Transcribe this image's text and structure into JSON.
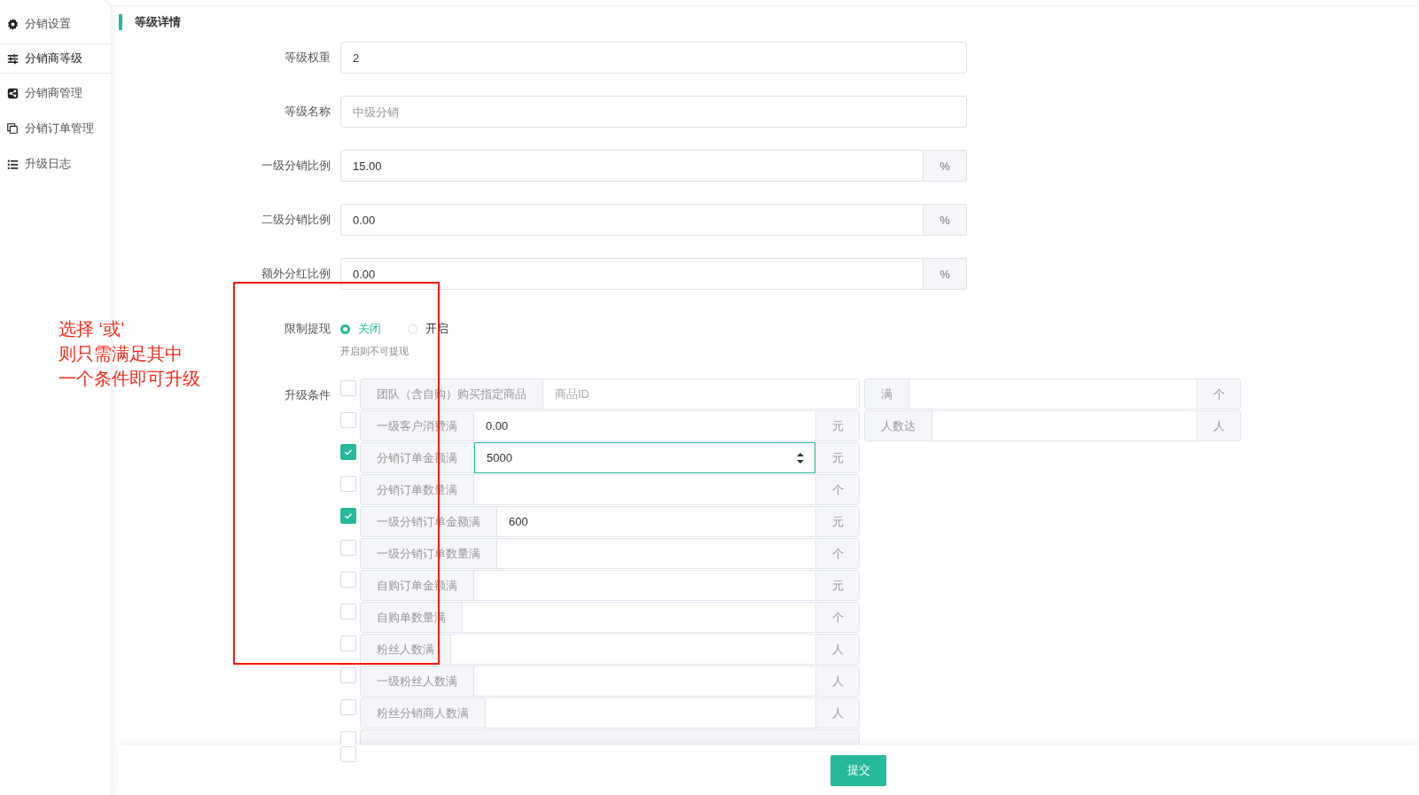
{
  "sidebar": {
    "items": [
      {
        "label": "分销设置",
        "selected": false
      },
      {
        "label": "分销商等级",
        "selected": true
      },
      {
        "label": "分销商管理",
        "selected": false
      },
      {
        "label": "分销订单管理",
        "selected": false
      },
      {
        "label": "升级日志",
        "selected": false
      }
    ]
  },
  "section_title": "等级详情",
  "fields": [
    {
      "label": "等级权重",
      "value": "2"
    },
    {
      "label": "等级名称",
      "placeholder": "中级分销"
    },
    {
      "label": "一级分销比例",
      "value": "15.00",
      "unit": "%"
    },
    {
      "label": "二级分销比例",
      "value": "0.00",
      "unit": "%"
    },
    {
      "label": "额外分红比例",
      "value": "0.00",
      "unit": "%"
    }
  ],
  "withdraw_limit": {
    "label": "限制提现",
    "options": [
      {
        "label": "关闭",
        "selected": true
      },
      {
        "label": "开启",
        "selected": false
      }
    ],
    "hint": "开启则不可提现"
  },
  "upgrade_conditions": {
    "label": "升级条件",
    "rows": [
      {
        "kind": "full",
        "checked": false,
        "label": "团队（含自购）购买指定商品",
        "placeholder": "商品ID",
        "extra": {
          "label": "满",
          "unit": "个"
        }
      },
      {
        "kind": "full",
        "checked": false,
        "label": "一级客户消费满",
        "value": "0.00",
        "unit": "元",
        "extra": {
          "label": "人数达",
          "unit": "人"
        }
      },
      {
        "kind": "full",
        "checked": true,
        "label": "分销订单金额满",
        "value": "5000",
        "unit": "元",
        "focused": true
      },
      {
        "kind": "full",
        "checked": false,
        "label": "分销订单数量满",
        "unit": "个"
      },
      {
        "kind": "full",
        "checked": true,
        "label": "一级分销订单金额满",
        "value": "600",
        "unit": "元"
      },
      {
        "kind": "full",
        "checked": false,
        "label": "一级分销订单数量满",
        "unit": "个"
      },
      {
        "kind": "full",
        "checked": false,
        "label": "自购订单金额满",
        "unit": "元"
      },
      {
        "kind": "full",
        "checked": false,
        "label": "自购单数量满",
        "unit": "个"
      },
      {
        "kind": "full",
        "checked": false,
        "label": "粉丝人数满",
        "unit": "人"
      },
      {
        "kind": "full",
        "checked": false,
        "label": "一级粉丝人数满",
        "unit": "人"
      },
      {
        "kind": "full",
        "checked": false,
        "label": "粉丝分销商人数满",
        "unit": "人"
      },
      {
        "kind": "hidden",
        "checked": false
      },
      {
        "kind": "checkbox_only",
        "checked": false
      }
    ]
  },
  "footer": {
    "submit": "提交"
  },
  "annotation": {
    "lines": [
      "选择 ‘或’",
      "则只需满足其中",
      "一个条件即可升级"
    ]
  }
}
